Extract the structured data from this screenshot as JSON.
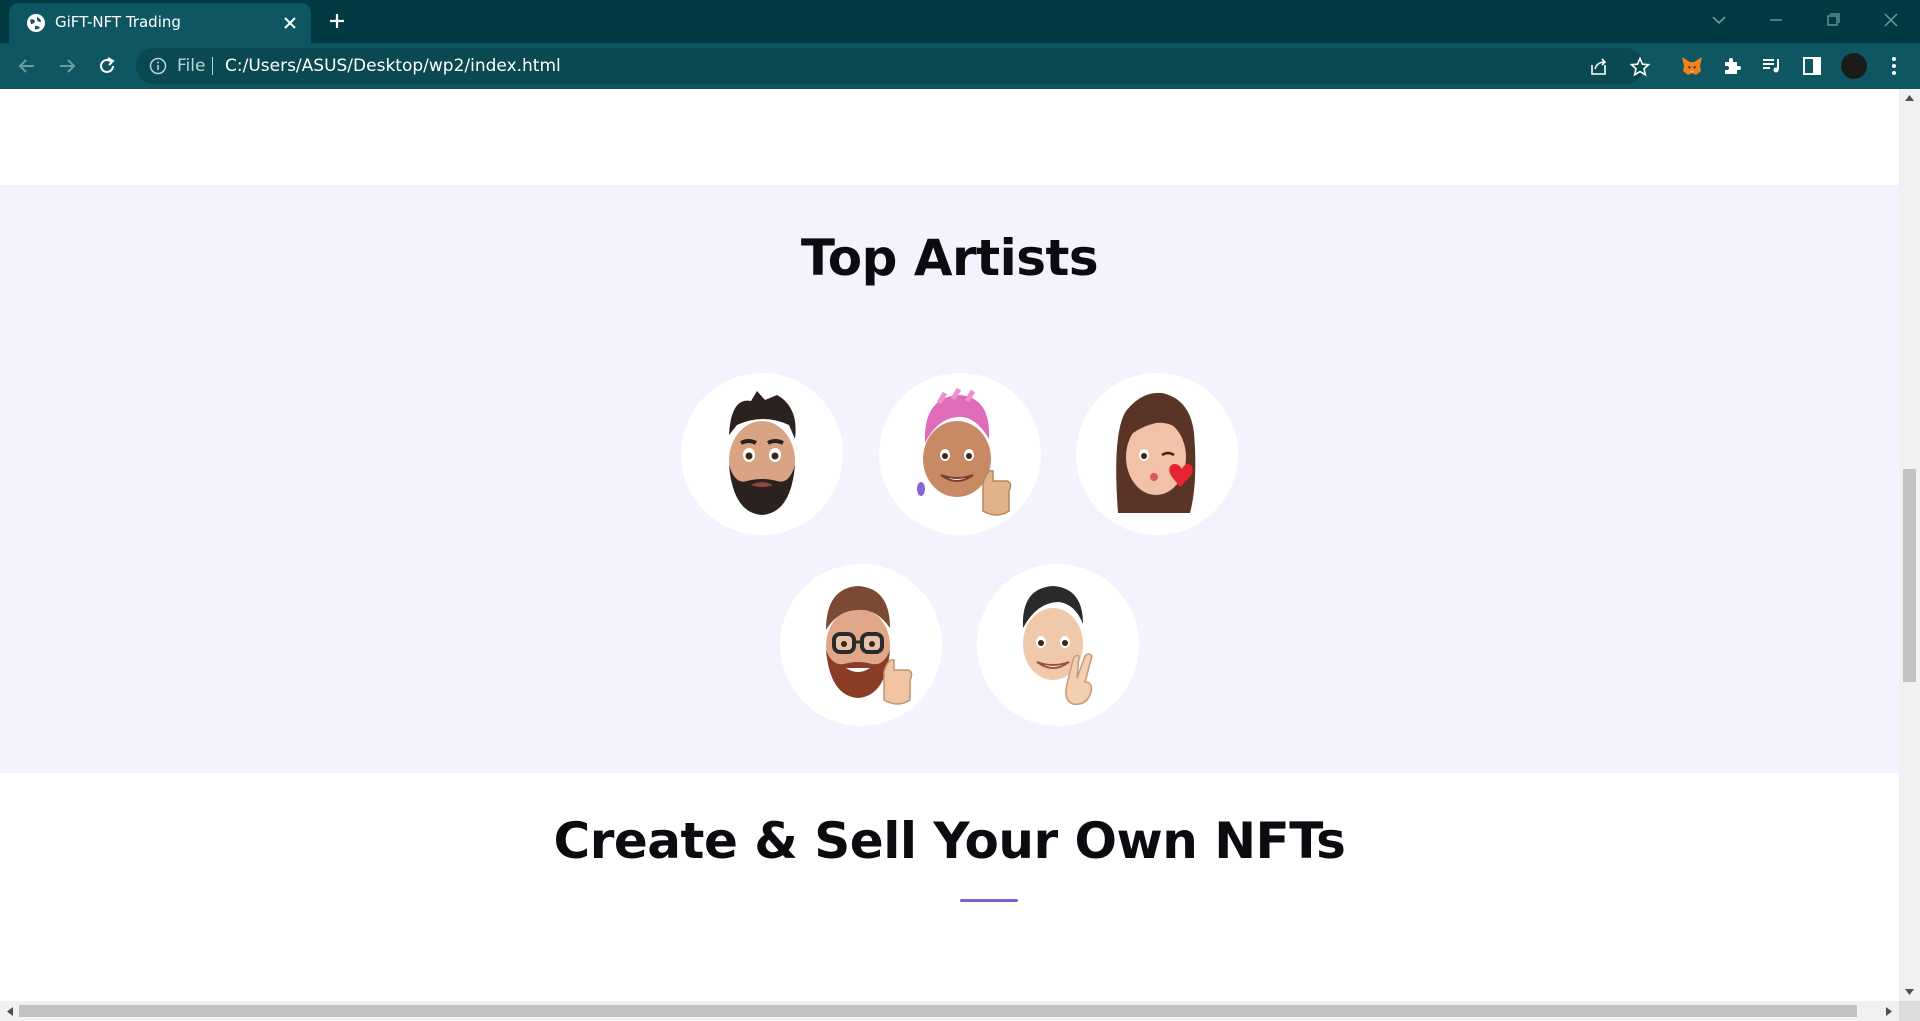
{
  "browser": {
    "tab_title": "GiFT-NFT Trading",
    "file_label": "File",
    "url": "C:/Users/ASUS/Desktop/wp2/index.html",
    "icons": {
      "tab": "globe-icon",
      "close": "close-icon",
      "new_tab": "plus-icon",
      "back": "back-arrow-icon",
      "forward": "forward-arrow-icon",
      "reload": "reload-icon",
      "info": "info-icon",
      "share": "share-icon",
      "bookmark": "star-icon",
      "extension_fox": "metamask-fox-icon",
      "extensions": "puzzle-icon",
      "media": "media-playlist-icon",
      "side_panel": "side-panel-icon",
      "profile": "profile-avatar",
      "menu": "kebab-menu-icon"
    }
  },
  "page": {
    "top_artists": {
      "title": "Top Artists",
      "accent_color": "#7a5fd6",
      "background": "#f5f2fd",
      "artists": [
        {
          "avatar": "bearded-man-memoji"
        },
        {
          "avatar": "pink-hair-thumbs-up-memoji"
        },
        {
          "avatar": "woman-kiss-heart-memoji"
        },
        {
          "avatar": "glasses-beard-thumbs-up-memoji"
        },
        {
          "avatar": "peace-sign-man-memoji"
        }
      ]
    },
    "create_sell": {
      "title": "Create & Sell Your Own NFTs",
      "accent_color": "#7a5fd6"
    }
  }
}
